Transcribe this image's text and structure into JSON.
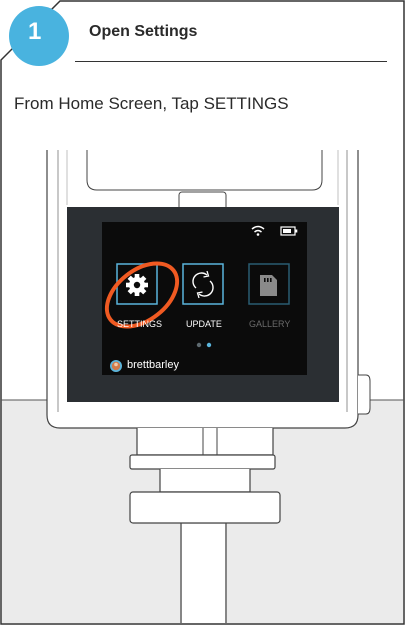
{
  "step": {
    "number": "1",
    "title": "Open Settings",
    "instruction": "From Home Screen, Tap SETTINGS"
  },
  "colors": {
    "accent_blue": "#5bb5dc",
    "highlight_orange": "#f05a22",
    "step_badge": "#49b3df",
    "screen_bg": "#0b0b0b"
  },
  "device_screen": {
    "status_icons": [
      "wifi-icon",
      "battery-icon"
    ],
    "apps": [
      {
        "label": "SETTINGS",
        "icon": "gear-icon",
        "selected": true
      },
      {
        "label": "UPDATE",
        "icon": "refresh-icon",
        "selected": false
      },
      {
        "label": "GALLERY",
        "icon": "sd-card-icon",
        "selected": false
      }
    ],
    "page_dots": {
      "count": 2,
      "active_index": 1
    },
    "user": {
      "name": "brettbarley"
    }
  }
}
